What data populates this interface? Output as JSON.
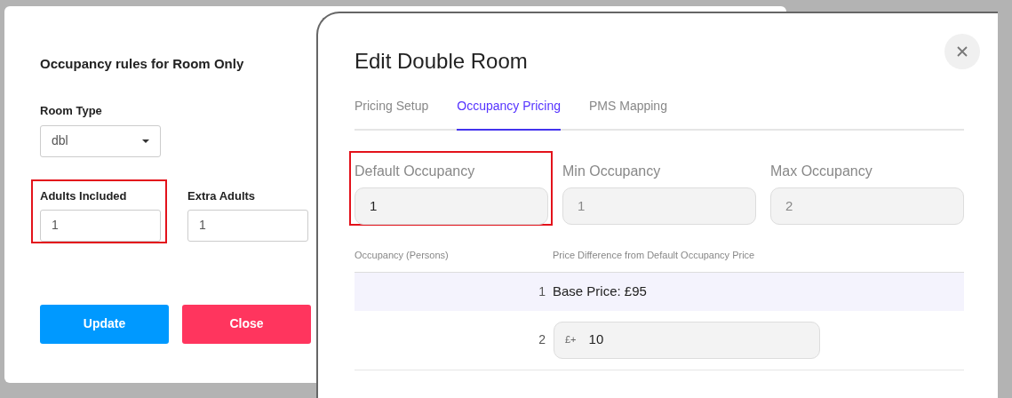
{
  "rules_dialog": {
    "title": "Occupancy rules for Room Only",
    "room_type": {
      "label": "Room Type",
      "value": "dbl"
    },
    "fields": [
      {
        "label": "Adults Included",
        "value": "1",
        "highlighted": true
      },
      {
        "label": "Extra Adults",
        "value": "1",
        "highlighted": false
      }
    ],
    "buttons": [
      {
        "label": "Update",
        "kind": "primary"
      },
      {
        "label": "Close",
        "kind": "danger"
      }
    ]
  },
  "edit_dialog": {
    "title": "Edit Double Room",
    "tabs": [
      {
        "label": "Pricing Setup",
        "selected": false
      },
      {
        "label": "Occupancy Pricing",
        "selected": true
      },
      {
        "label": "PMS Mapping",
        "selected": false
      }
    ],
    "fields": [
      {
        "label": "Default Occupancy",
        "value": "1",
        "highlighted": true,
        "disabled": false
      },
      {
        "label": "Min Occupancy",
        "value": "1",
        "highlighted": false,
        "disabled": true
      },
      {
        "label": "Max Occupancy",
        "value": "2",
        "highlighted": false,
        "disabled": true
      }
    ],
    "table": {
      "columns": [
        "Occupancy (Persons)",
        "Price Difference from Default Occupancy Price"
      ],
      "rows": [
        {
          "persons": "1",
          "kind": "base",
          "text": "Base Price: £95"
        },
        {
          "persons": "2",
          "kind": "input",
          "prefix": "£+",
          "value": "10"
        }
      ]
    }
  }
}
